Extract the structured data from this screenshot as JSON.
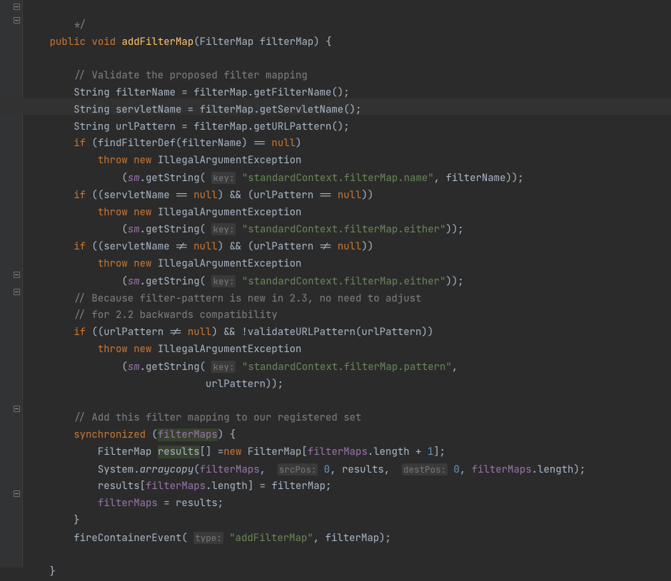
{
  "code": {
    "l0_cmt": "*/",
    "l1_kw_public": "public",
    "l1_kw_void": "void",
    "l1_fn": "addFilterMap",
    "l1_type": "FilterMap",
    "l1_param": "filterMap",
    "l3_cmt": "// Validate the proposed filter mapping",
    "l4a": "String filterName = filterMap.getFilterName();",
    "l4": "String servletName = filterMap.getServletName();",
    "l5": "String urlPattern = filterMap.getURLPattern();",
    "l6_if": "if",
    "l6_body": " (findFilterDef(filterName) == ",
    "null": "null",
    "throw": "throw",
    "new": "new",
    "iae": " IllegalArgumentException",
    "sm": "sm",
    "getString": ".getString(",
    "keyHint": "key:",
    "str_name": "\"standardContext.filterMap.name\"",
    "filterName": "filterName",
    "l9": " ((servletName == ",
    "and": ") && (urlPattern == ",
    "str_either": "\"standardContext.filterMap.either\"",
    "l12": " ((servletName != ",
    "and2": ") && (urlPattern != ",
    "cmt_because1": "// Because filter-pattern is new in 2.3, no need to adjust",
    "cmt_because2": "// for 2.2 backwards compatibility",
    "l16": " ((urlPattern != ",
    "l16b": ") && !validateURLPattern(urlPattern))",
    "str_pattern": "\"standardContext.filterMap.pattern\"",
    "urlPattern": "urlPattern",
    "cmt_add": "// Add this filter mapping to our registered set",
    "sync": "synchronized",
    "filterMaps": "filterMaps",
    "results": "results",
    "l22a": "FilterMap ",
    "l22b": "[] =",
    "l22c": " FilterMap[",
    "l22d": ".length + ",
    "one": "1",
    "zero": "0",
    "System": "System.",
    "arraycopy": "arraycopy",
    "srcPos": "srcPos:",
    "destPos": "destPos:",
    "comma_results": ", results, ",
    "length_end": ".length);",
    "l24": "results[",
    "l24b": ".length] = filterMap;",
    "l25a": " = results;",
    "fire": "fireContainerEvent(",
    "typeHint": "type:",
    "str_add": "\"addFilterMap\"",
    "filterMap_end": ", filterMap);"
  }
}
